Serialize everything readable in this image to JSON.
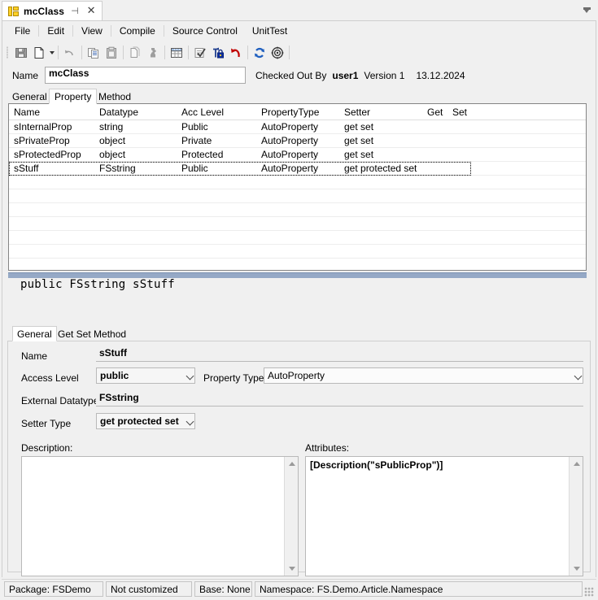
{
  "tab": {
    "title": "mcClass",
    "icon": "class-icon",
    "pin_icon": "pin-icon",
    "close_icon": "close-icon",
    "overflow_icon": "chevron-down-icon"
  },
  "menu": {
    "items": [
      {
        "label": "File"
      },
      {
        "label": "Edit"
      },
      {
        "label": "View"
      },
      {
        "label": "Compile"
      },
      {
        "label": "Source Control"
      },
      {
        "label": "UnitTest"
      }
    ]
  },
  "toolbar": {
    "buttons": [
      {
        "name": "save-icon",
        "label": "Save"
      },
      {
        "name": "new-file-icon",
        "label": "New"
      },
      {
        "name": "undo-arrow-icon",
        "label": "Undo"
      },
      {
        "name": "copy-icon",
        "label": "Copy"
      },
      {
        "name": "paste-icon",
        "label": "Paste"
      },
      {
        "name": "duplicate-icon",
        "label": "Duplicate"
      },
      {
        "name": "puzzle-icon",
        "label": "Plugin"
      },
      {
        "name": "table-icon",
        "label": "Grid"
      },
      {
        "name": "checklist-icon",
        "label": "Check"
      },
      {
        "name": "lock-icon",
        "label": "Check Out"
      },
      {
        "name": "undo-red-icon",
        "label": "Undo Checkout"
      },
      {
        "name": "refresh-icon",
        "label": "Refresh"
      },
      {
        "name": "target-icon",
        "label": "Target"
      }
    ]
  },
  "header": {
    "name_label": "Name",
    "name_value": "mcClass",
    "checked_out_label": "Checked Out By",
    "checked_out_user": "user1",
    "version_label": "Version 1",
    "date": "13.12.2024"
  },
  "main_tabs": {
    "items": [
      {
        "label": "General"
      },
      {
        "label": "Property"
      },
      {
        "label": "Method"
      }
    ],
    "active_index": 1
  },
  "grid": {
    "columns": [
      "Name",
      "Datatype",
      "Acc Level",
      "PropertyType",
      "Setter",
      "Get",
      "Set"
    ],
    "rows": [
      {
        "Name": "sInternalProp",
        "Datatype": "string",
        "Acc Level": "Public",
        "PropertyType": "AutoProperty",
        "Setter": "get set",
        "Get": "",
        "Set": ""
      },
      {
        "Name": "sPrivateProp",
        "Datatype": "object",
        "Acc Level": "Private",
        "PropertyType": "AutoProperty",
        "Setter": "get set",
        "Get": "",
        "Set": ""
      },
      {
        "Name": "sProtectedProp",
        "Datatype": "object",
        "Acc Level": "Protected",
        "PropertyType": "AutoProperty",
        "Setter": "get set",
        "Get": "",
        "Set": ""
      },
      {
        "Name": "sStuff",
        "Datatype": "FSstring",
        "Acc Level": "Public",
        "PropertyType": "AutoProperty",
        "Setter": "get protected set",
        "Get": "",
        "Set": ""
      }
    ],
    "selected_row_index": 3
  },
  "detail": {
    "signature": "public FSstring sStuff",
    "tabs": {
      "items": [
        {
          "label": "General"
        },
        {
          "label": "Get Set Method"
        }
      ],
      "active_index": 0
    },
    "fields": {
      "name_label": "Name",
      "name_value": "sStuff",
      "access_level_label": "Access Level",
      "access_level_value": "public",
      "property_type_label": "Property Type",
      "property_type_value": "AutoProperty",
      "external_datatype_label": "External Datatype",
      "external_datatype_value": "FSstring",
      "setter_type_label": "Setter Type",
      "setter_type_value": "get protected set"
    },
    "description": {
      "label": "Description:",
      "value": ""
    },
    "attributes": {
      "label": "Attributes:",
      "value": "[Description(\"sPublicProp\")]"
    }
  },
  "statusbar": {
    "panels": [
      {
        "text": "Package: FSDemo"
      },
      {
        "text": "Not customized"
      },
      {
        "text": "Base: None"
      },
      {
        "text": "Namespace: FS.Demo.Article.Namespace"
      }
    ]
  },
  "colors": {
    "splitter": "#95a9c6",
    "tab_icon": "#ffd027",
    "accent_blue": "#1f5fbf",
    "accent_red": "#c00000"
  }
}
